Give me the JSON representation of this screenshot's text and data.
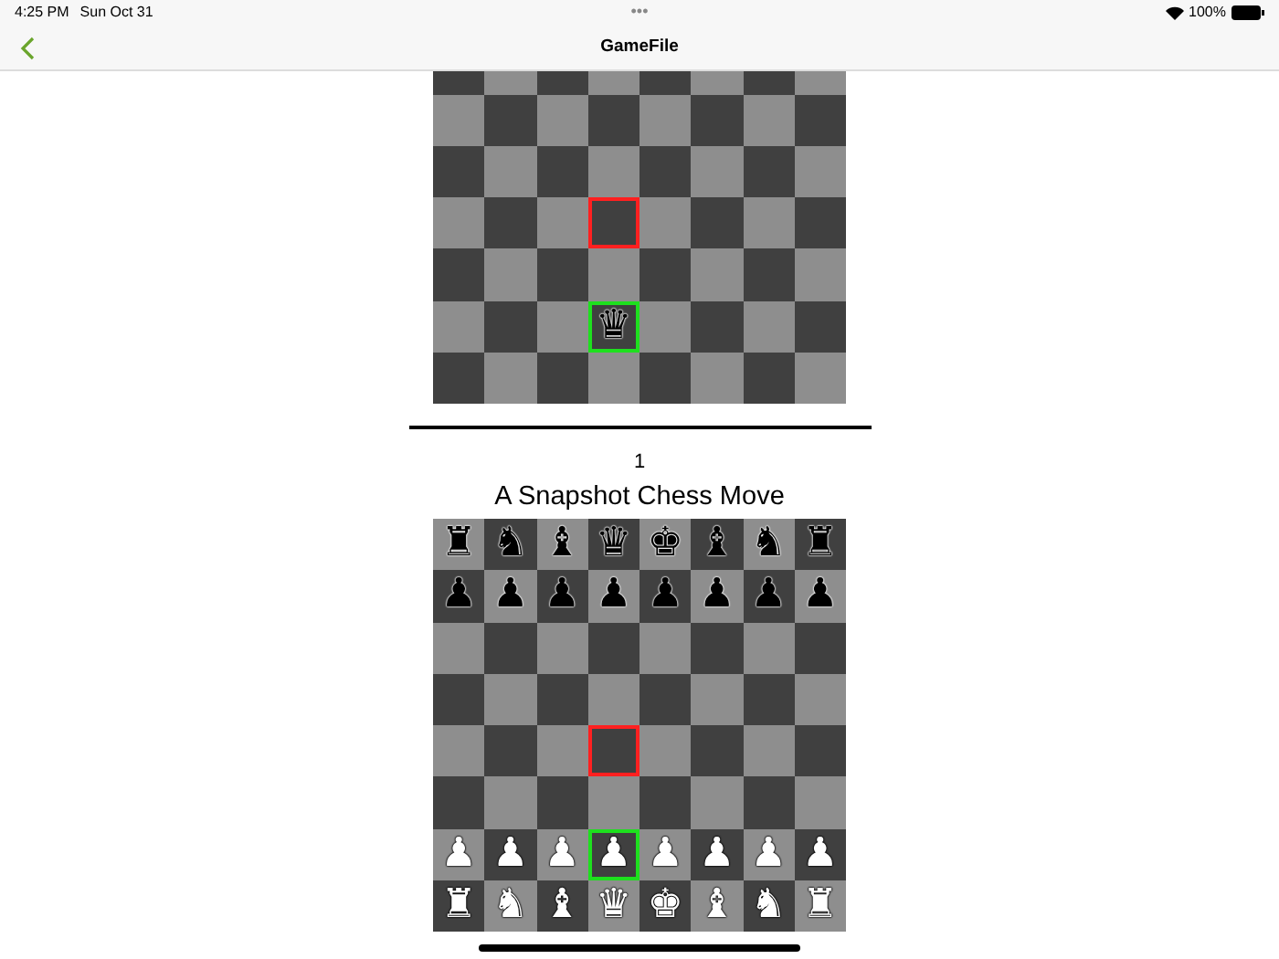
{
  "status_bar": {
    "time": "4:25 PM",
    "date": "Sun Oct 31",
    "dots": "•••",
    "battery_text": "100%"
  },
  "nav": {
    "title": "GameFile"
  },
  "boards": [
    {
      "rows": [
        [
          {
            "from": false,
            "to": false
          },
          {
            "from": false,
            "to": false
          },
          {
            "from": false,
            "to": false
          },
          {
            "from": false,
            "to": false
          },
          {
            "from": false,
            "to": false
          },
          {
            "from": false,
            "to": false
          },
          {
            "from": false,
            "to": false
          },
          {
            "from": false,
            "to": false
          }
        ],
        [
          {
            "from": false,
            "to": false
          },
          {
            "from": false,
            "to": false
          },
          {
            "from": false,
            "to": false
          },
          {
            "from": false,
            "to": false
          },
          {
            "from": false,
            "to": false
          },
          {
            "from": false,
            "to": false
          },
          {
            "from": false,
            "to": false
          },
          {
            "from": false,
            "to": false
          }
        ],
        [
          {
            "from": false,
            "to": false
          },
          {
            "from": false,
            "to": false
          },
          {
            "from": false,
            "to": false
          },
          {
            "from": false,
            "to": false
          },
          {
            "from": false,
            "to": false
          },
          {
            "from": false,
            "to": false
          },
          {
            "from": false,
            "to": false
          },
          {
            "from": false,
            "to": false
          }
        ],
        [
          {
            "from": false,
            "to": false
          },
          {
            "from": false,
            "to": false
          },
          {
            "from": false,
            "to": false
          },
          {
            "from": true,
            "to": false
          },
          {
            "from": false,
            "to": false
          },
          {
            "from": false,
            "to": false
          },
          {
            "from": false,
            "to": false
          },
          {
            "from": false,
            "to": false
          }
        ],
        [
          {
            "from": false,
            "to": false
          },
          {
            "from": false,
            "to": false
          },
          {
            "from": false,
            "to": false
          },
          {
            "from": false,
            "to": false
          },
          {
            "from": false,
            "to": false
          },
          {
            "from": false,
            "to": false
          },
          {
            "from": false,
            "to": false
          },
          {
            "from": false,
            "to": false
          }
        ],
        [
          {
            "from": false,
            "to": false
          },
          {
            "from": false,
            "to": false
          },
          {
            "from": false,
            "to": false
          },
          {
            "from": false,
            "to": true,
            "piece": "♛",
            "white": false
          },
          {
            "from": false,
            "to": false
          },
          {
            "from": false,
            "to": false
          },
          {
            "from": false,
            "to": false
          },
          {
            "from": false,
            "to": false
          }
        ],
        [
          {
            "from": false,
            "to": false
          },
          {
            "from": false,
            "to": false
          },
          {
            "from": false,
            "to": false
          },
          {
            "from": false,
            "to": false
          },
          {
            "from": false,
            "to": false
          },
          {
            "from": false,
            "to": false
          },
          {
            "from": false,
            "to": false
          },
          {
            "from": false,
            "to": false
          }
        ]
      ]
    },
    {
      "number": "1",
      "title": "A Snapshot Chess Move",
      "rows": [
        [
          {
            "from": false,
            "to": false,
            "piece": "♜",
            "white": false
          },
          {
            "from": false,
            "to": false,
            "piece": "♞",
            "white": false
          },
          {
            "from": false,
            "to": false,
            "piece": "♝",
            "white": false
          },
          {
            "from": false,
            "to": false,
            "piece": "♛",
            "white": false
          },
          {
            "from": false,
            "to": false,
            "piece": "♚",
            "white": false
          },
          {
            "from": false,
            "to": false,
            "piece": "♝",
            "white": false
          },
          {
            "from": false,
            "to": false,
            "piece": "♞",
            "white": false
          },
          {
            "from": false,
            "to": false,
            "piece": "♜",
            "white": false
          }
        ],
        [
          {
            "from": false,
            "to": false,
            "piece": "♟",
            "white": false
          },
          {
            "from": false,
            "to": false,
            "piece": "♟",
            "white": false
          },
          {
            "from": false,
            "to": false,
            "piece": "♟",
            "white": false
          },
          {
            "from": false,
            "to": false,
            "piece": "♟",
            "white": false
          },
          {
            "from": false,
            "to": false,
            "piece": "♟",
            "white": false
          },
          {
            "from": false,
            "to": false,
            "piece": "♟",
            "white": false
          },
          {
            "from": false,
            "to": false,
            "piece": "♟",
            "white": false
          },
          {
            "from": false,
            "to": false,
            "piece": "♟",
            "white": false
          }
        ],
        [
          {
            "from": false,
            "to": false
          },
          {
            "from": false,
            "to": false
          },
          {
            "from": false,
            "to": false
          },
          {
            "from": false,
            "to": false
          },
          {
            "from": false,
            "to": false
          },
          {
            "from": false,
            "to": false
          },
          {
            "from": false,
            "to": false
          },
          {
            "from": false,
            "to": false
          }
        ],
        [
          {
            "from": false,
            "to": false
          },
          {
            "from": false,
            "to": false
          },
          {
            "from": false,
            "to": false
          },
          {
            "from": false,
            "to": false
          },
          {
            "from": false,
            "to": false
          },
          {
            "from": false,
            "to": false
          },
          {
            "from": false,
            "to": false
          },
          {
            "from": false,
            "to": false
          }
        ],
        [
          {
            "from": false,
            "to": false
          },
          {
            "from": false,
            "to": false
          },
          {
            "from": false,
            "to": false
          },
          {
            "from": true,
            "to": false
          },
          {
            "from": false,
            "to": false
          },
          {
            "from": false,
            "to": false
          },
          {
            "from": false,
            "to": false
          },
          {
            "from": false,
            "to": false
          }
        ],
        [
          {
            "from": false,
            "to": false
          },
          {
            "from": false,
            "to": false
          },
          {
            "from": false,
            "to": false
          },
          {
            "from": false,
            "to": false
          },
          {
            "from": false,
            "to": false
          },
          {
            "from": false,
            "to": false
          },
          {
            "from": false,
            "to": false
          },
          {
            "from": false,
            "to": false
          }
        ],
        [
          {
            "from": false,
            "to": false,
            "piece": "♟",
            "white": true
          },
          {
            "from": false,
            "to": false,
            "piece": "♟",
            "white": true
          },
          {
            "from": false,
            "to": false,
            "piece": "♟",
            "white": true
          },
          {
            "from": false,
            "to": true,
            "piece": "♟",
            "white": true
          },
          {
            "from": false,
            "to": false,
            "piece": "♟",
            "white": true
          },
          {
            "from": false,
            "to": false,
            "piece": "♟",
            "white": true
          },
          {
            "from": false,
            "to": false,
            "piece": "♟",
            "white": true
          },
          {
            "from": false,
            "to": false,
            "piece": "♟",
            "white": true
          }
        ],
        [
          {
            "from": false,
            "to": false,
            "piece": "♜",
            "white": true
          },
          {
            "from": false,
            "to": false,
            "piece": "♞",
            "white": true
          },
          {
            "from": false,
            "to": false,
            "piece": "♝",
            "white": true
          },
          {
            "from": false,
            "to": false,
            "piece": "♛",
            "white": true
          },
          {
            "from": false,
            "to": false,
            "piece": "♚",
            "white": true
          },
          {
            "from": false,
            "to": false,
            "piece": "♝",
            "white": true
          },
          {
            "from": false,
            "to": false,
            "piece": "♞",
            "white": true
          },
          {
            "from": false,
            "to": false,
            "piece": "♜",
            "white": true
          }
        ]
      ]
    }
  ]
}
